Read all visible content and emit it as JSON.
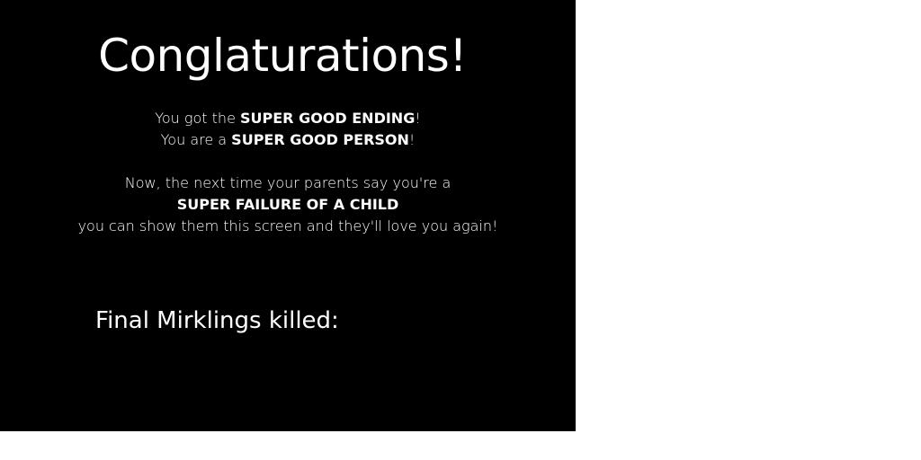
{
  "screen": {
    "title": "Conglaturations!",
    "line1": {
      "prefix": "You got the ",
      "emphasis": "SUPER GOOD ENDING",
      "suffix": "!"
    },
    "line2": {
      "prefix": "You are a ",
      "emphasis": "SUPER GOOD PERSON",
      "suffix": "!"
    },
    "line3": "Now, the next time your parents say you're a",
    "line4": "SUPER FAILURE OF A CHILD",
    "line5": "you can show them this screen and they'll love you again!",
    "stat_label": "Final Mirklings killed:",
    "stat_value": ""
  },
  "colors": {
    "panel_background": "#000000",
    "text": "#ffffff",
    "page_background": "#ffffff"
  }
}
